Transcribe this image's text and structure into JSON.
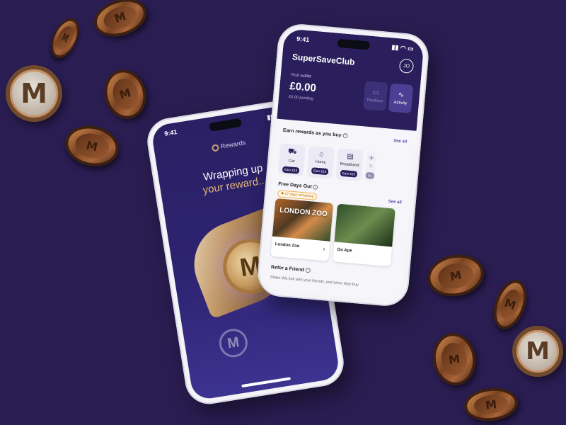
{
  "colors": {
    "background": "#2a1d52",
    "header_navy": "#2a1f5c",
    "gold": "#e3b876",
    "accent": "#5a4bb0"
  },
  "coin_letter": "M",
  "left_phone": {
    "time": "9:41",
    "tag": "Rewards",
    "title_line1": "Wrapping up",
    "title_line2": "your reward..."
  },
  "right_phone": {
    "time": "9:41",
    "app_title": "SuperSaveClub",
    "avatar_initials": "JO",
    "wallet": {
      "label": "Your wallet",
      "amount": "£0.00",
      "pending": "£0.00 pending"
    },
    "buttons": {
      "redeem": "Redeem",
      "activity": "Activity"
    },
    "earn_section": {
      "title": "Earn rewards as you buy",
      "see_all": "See all",
      "categories": [
        {
          "label": "Car",
          "earn": "Earn £15",
          "icon": "car-icon"
        },
        {
          "label": "Home",
          "earn": "Earn £15",
          "icon": "home-icon"
        },
        {
          "label": "Broadband",
          "earn": "Earn £15",
          "icon": "router-icon"
        },
        {
          "label": "Tr",
          "earn": "Ea",
          "icon": "travel-icon"
        }
      ]
    },
    "free_days": {
      "title": "Free Days Out",
      "remaining": "27 days remaining",
      "see_all": "See all",
      "places": [
        {
          "name": "London Zoo",
          "logo": "LONDON ZOO"
        },
        {
          "name": "Go Ape"
        }
      ]
    },
    "refer": {
      "title": "Refer a Friend",
      "text": "Share this link with your friends, and when they buy"
    }
  }
}
